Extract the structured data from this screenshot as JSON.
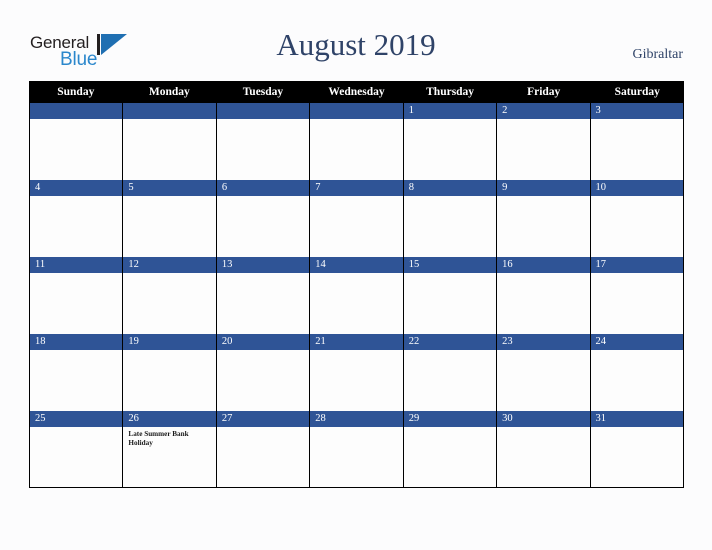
{
  "brand": {
    "name_part1": "General",
    "name_part2": "Blue",
    "mark": "triangle-logo",
    "color_dark": "#231f20",
    "color_blue": "#2b87cc",
    "color_mark": "#1f6fb2"
  },
  "header": {
    "title": "August 2019",
    "country": "Gibraltar",
    "title_color": "#2f4368"
  },
  "calendar": {
    "header_bg": "#000000",
    "banner_bg": "#2f5496",
    "weekdays": [
      "Sunday",
      "Monday",
      "Tuesday",
      "Wednesday",
      "Thursday",
      "Friday",
      "Saturday"
    ],
    "weeks": [
      [
        {
          "day": "",
          "events": []
        },
        {
          "day": "",
          "events": []
        },
        {
          "day": "",
          "events": []
        },
        {
          "day": "",
          "events": []
        },
        {
          "day": "1",
          "events": []
        },
        {
          "day": "2",
          "events": []
        },
        {
          "day": "3",
          "events": []
        }
      ],
      [
        {
          "day": "4",
          "events": []
        },
        {
          "day": "5",
          "events": []
        },
        {
          "day": "6",
          "events": []
        },
        {
          "day": "7",
          "events": []
        },
        {
          "day": "8",
          "events": []
        },
        {
          "day": "9",
          "events": []
        },
        {
          "day": "10",
          "events": []
        }
      ],
      [
        {
          "day": "11",
          "events": []
        },
        {
          "day": "12",
          "events": []
        },
        {
          "day": "13",
          "events": []
        },
        {
          "day": "14",
          "events": []
        },
        {
          "day": "15",
          "events": []
        },
        {
          "day": "16",
          "events": []
        },
        {
          "day": "17",
          "events": []
        }
      ],
      [
        {
          "day": "18",
          "events": []
        },
        {
          "day": "19",
          "events": []
        },
        {
          "day": "20",
          "events": []
        },
        {
          "day": "21",
          "events": []
        },
        {
          "day": "22",
          "events": []
        },
        {
          "day": "23",
          "events": []
        },
        {
          "day": "24",
          "events": []
        }
      ],
      [
        {
          "day": "25",
          "events": []
        },
        {
          "day": "26",
          "events": [
            "Late Summer Bank Holiday"
          ]
        },
        {
          "day": "27",
          "events": []
        },
        {
          "day": "28",
          "events": []
        },
        {
          "day": "29",
          "events": []
        },
        {
          "day": "30",
          "events": []
        },
        {
          "day": "31",
          "events": []
        }
      ]
    ]
  }
}
